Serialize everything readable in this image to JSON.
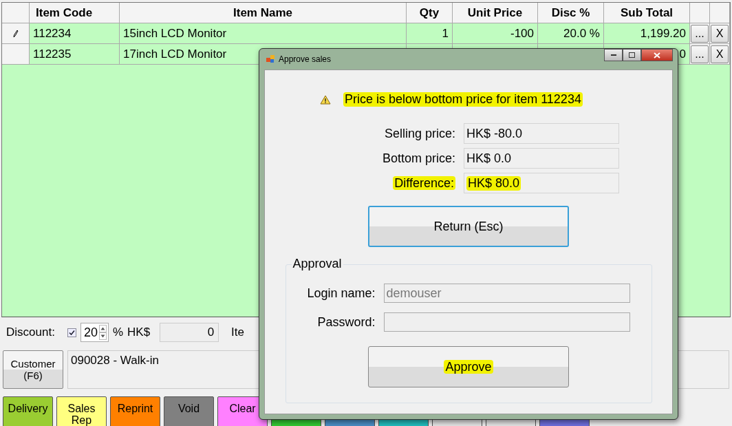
{
  "grid": {
    "columns": [
      "Item Code",
      "Item Name",
      "Qty",
      "Unit Price",
      "Disc %",
      "Sub Total"
    ],
    "rows": [
      {
        "editing": true,
        "item_code": "112234",
        "item_name": "15inch LCD Monitor",
        "qty": "1",
        "unit_price": "-100",
        "disc": "20.0 %",
        "sub_total": "1,199.20",
        "more": "...",
        "remove": "X"
      },
      {
        "editing": false,
        "item_code": "112235",
        "item_name": "17inch LCD Monitor",
        "sub_total": "0",
        "more": "...",
        "remove": "X"
      }
    ]
  },
  "discount": {
    "label": "Discount:",
    "enabled": true,
    "percent": "20",
    "percent_sign": "%",
    "currency": "HK$",
    "amount": "0",
    "next_label": "Ite"
  },
  "customer": {
    "button": "Customer (F6)",
    "value": "090028 - Walk-in"
  },
  "actions": [
    {
      "label": "Delivery",
      "color": "#9acd32"
    },
    {
      "label": "Sales Rep",
      "color": "#ffff80"
    },
    {
      "label": "Reprint",
      "color": "#ff8000"
    },
    {
      "label": "Void",
      "color": "#808080"
    },
    {
      "label": "Clear",
      "color": "#ff80ff"
    },
    {
      "color": "#33cc33"
    },
    {
      "color": "#4a90c8"
    },
    {
      "color": "#20c0c0"
    },
    {
      "color": "#e8e8e8"
    },
    {
      "color": "#e8e8e8"
    },
    {
      "color": "#7070e0"
    }
  ],
  "dialog": {
    "title": "Approve sales",
    "message": "Price is below bottom price for item 112234",
    "message_highlighted": true,
    "fields": [
      {
        "label": "Selling price:",
        "value": "HK$ -80.0",
        "highlighted": false
      },
      {
        "label": "Bottom price:",
        "value": "HK$ 0.0",
        "highlighted": false
      },
      {
        "label": "Difference:",
        "value": "HK$ 80.0",
        "highlighted": true
      }
    ],
    "return_button": {
      "label": "Return (Esc)",
      "focused": true
    },
    "approval": {
      "title": "Approval",
      "login_label": "Login name:",
      "login_value": "demouser",
      "password_label": "Password:"
    },
    "approve_button": {
      "label": "Approve",
      "highlighted": true
    }
  }
}
